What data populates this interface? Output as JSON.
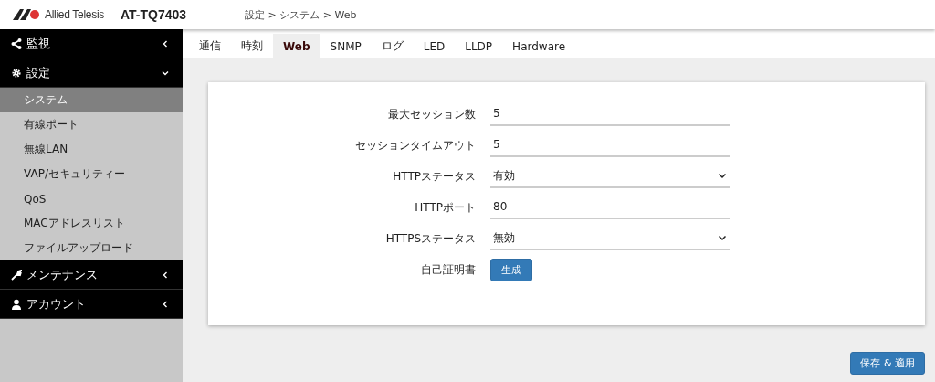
{
  "header": {
    "brand": "Allied Telesis",
    "model": "AT-TQ7403",
    "breadcrumb": "設定 > システム > Web"
  },
  "sidebar": [
    {
      "label": "監視",
      "expanded": false
    },
    {
      "label": "設定",
      "expanded": true,
      "items": [
        {
          "label": "システム",
          "selected": true
        },
        {
          "label": "有線ポート",
          "selected": false
        },
        {
          "label": "無線LAN",
          "selected": false
        },
        {
          "label": "VAP/セキュリティー",
          "selected": false
        },
        {
          "label": "QoS",
          "selected": false
        },
        {
          "label": "MACアドレスリスト",
          "selected": false
        },
        {
          "label": "ファイルアップロード",
          "selected": false
        }
      ]
    },
    {
      "label": "メンテナンス",
      "expanded": false
    },
    {
      "label": "アカウント",
      "expanded": false
    }
  ],
  "tabs": [
    {
      "label": "通信",
      "selected": false
    },
    {
      "label": "時刻",
      "selected": false
    },
    {
      "label": "Web",
      "selected": true
    },
    {
      "label": "SNMP",
      "selected": false
    },
    {
      "label": "ログ",
      "selected": false
    },
    {
      "label": "LED",
      "selected": false
    },
    {
      "label": "LLDP",
      "selected": false
    },
    {
      "label": "Hardware",
      "selected": false
    }
  ],
  "form": [
    {
      "label": "最大セッション数",
      "kind": "text",
      "value": "5"
    },
    {
      "label": "セッションタイムアウト",
      "kind": "text",
      "value": "5"
    },
    {
      "label": "HTTPステータス",
      "kind": "select",
      "value": "有効"
    },
    {
      "label": "HTTPポート",
      "kind": "text",
      "value": "80"
    },
    {
      "label": "HTTPSステータス",
      "kind": "select",
      "value": "無効"
    },
    {
      "label": "自己証明書",
      "kind": "button",
      "value": "生成"
    }
  ],
  "save_button": "保存 & 適用"
}
